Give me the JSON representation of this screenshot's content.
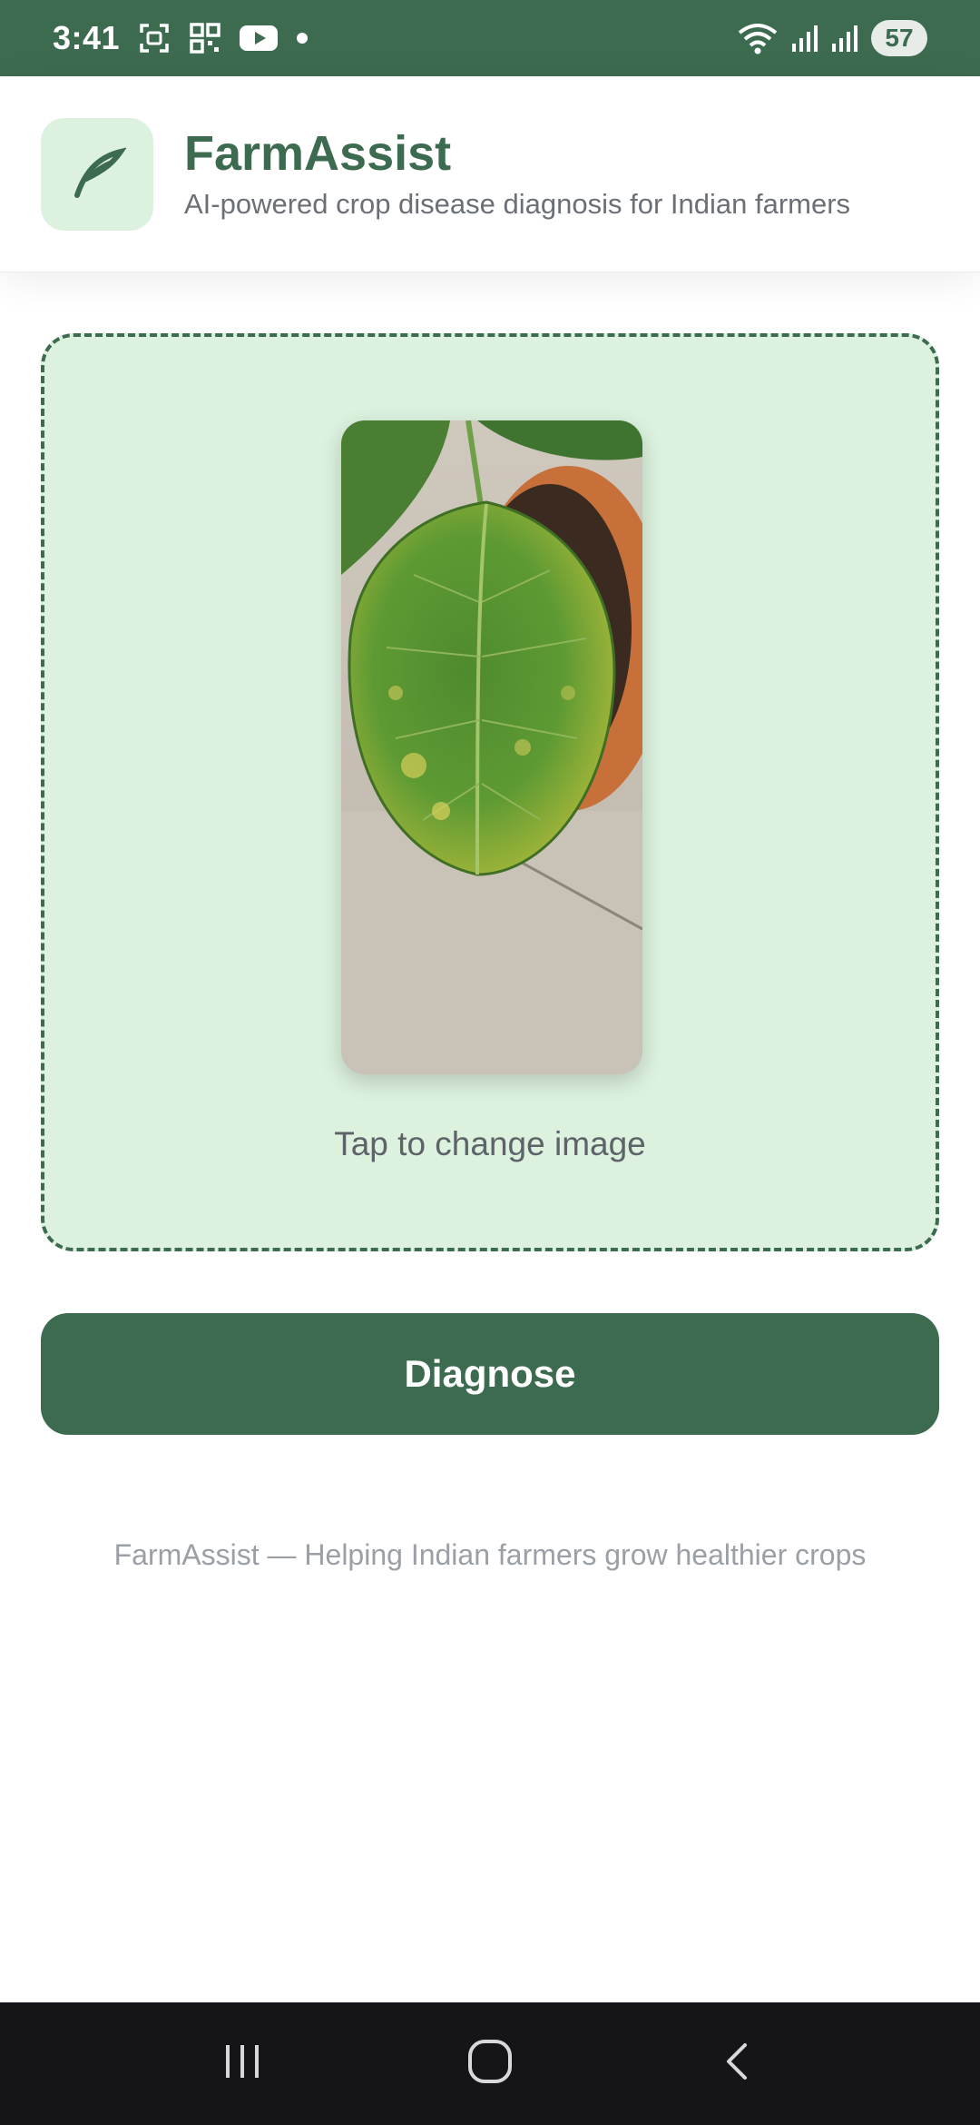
{
  "status_bar": {
    "time": "3:41",
    "battery": "57",
    "icons": [
      "screenshot-icon",
      "qr-icon",
      "youtube-icon",
      "notification-dot-icon",
      "wifi-icon",
      "signal-icon",
      "signal-icon-2",
      "battery-icon"
    ]
  },
  "header": {
    "title": "FarmAssist",
    "subtitle": "AI-powered crop disease diagnosis for Indian farmers",
    "logo_icon": "leaf-icon"
  },
  "upload": {
    "hint": "Tap to change image",
    "image": "leaf-photo"
  },
  "actions": {
    "diagnose_label": "Diagnose"
  },
  "footer": {
    "tagline": "FarmAssist — Helping Indian farmers grow healthier crops"
  },
  "nav": {
    "icons": [
      "recents-icon",
      "home-icon",
      "back-icon"
    ]
  },
  "colors": {
    "primary": "#3d6b50",
    "card_bg": "#dcf1de",
    "nav_bg": "#141419"
  }
}
